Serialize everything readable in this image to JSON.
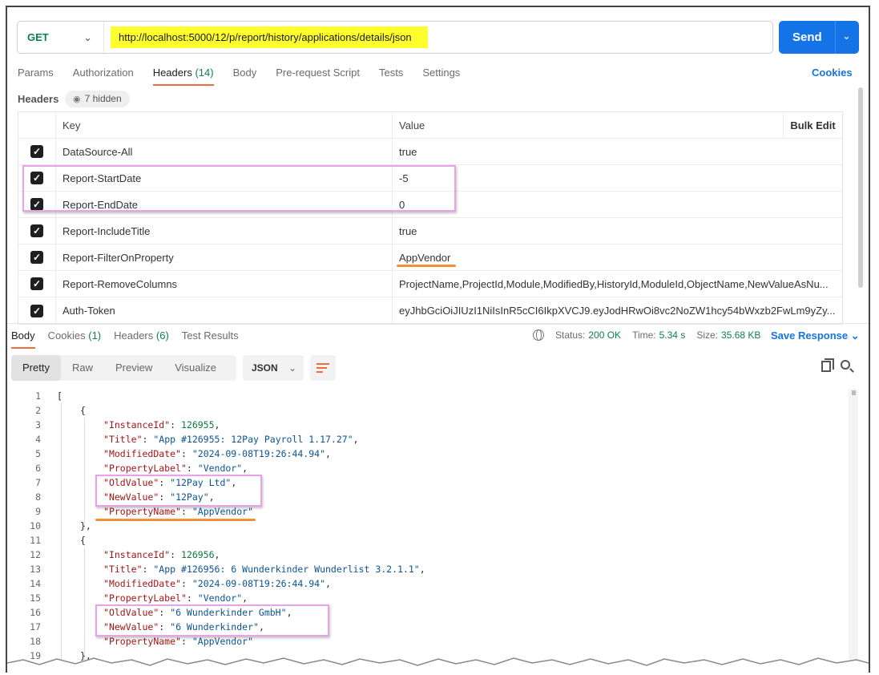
{
  "request": {
    "method": "GET",
    "url": "http://localhost:5000/12/p/report/history/applications/details/json",
    "send_label": "Send"
  },
  "req_tabs": [
    {
      "label": "Params",
      "count": ""
    },
    {
      "label": "Authorization",
      "count": ""
    },
    {
      "label": "Headers",
      "count": "(14)"
    },
    {
      "label": "Body",
      "count": ""
    },
    {
      "label": "Pre-request Script",
      "count": ""
    },
    {
      "label": "Tests",
      "count": ""
    },
    {
      "label": "Settings",
      "count": ""
    }
  ],
  "cookies_label": "Cookies",
  "headers_section": {
    "label": "Headers",
    "hidden_label": "7 hidden",
    "col_key": "Key",
    "col_value": "Value",
    "bulk_edit": "Bulk Edit",
    "rows": [
      {
        "key": "DataSource-All",
        "value": "true"
      },
      {
        "key": "Report-StartDate",
        "value": "-5"
      },
      {
        "key": "Report-EndDate",
        "value": "0"
      },
      {
        "key": "Report-IncludeTitle",
        "value": "true"
      },
      {
        "key": "Report-FilterOnProperty",
        "value": "AppVendor"
      },
      {
        "key": "Report-RemoveColumns",
        "value": "ProjectName,ProjectId,Module,ModifiedBy,HistoryId,ModuleId,ObjectName,NewValueAsNu..."
      },
      {
        "key": "Auth-Token",
        "value": "eyJhbGciOiJIUzI1NiIsInR5cCI6IkpXVCJ9.eyJodHRwOi8vc2NoZW1hcy54bWxzb2FwLm9yZy..."
      }
    ]
  },
  "resp_tabs": [
    {
      "label": "Body",
      "count": ""
    },
    {
      "label": "Cookies",
      "count": "(1)"
    },
    {
      "label": "Headers",
      "count": "(6)"
    },
    {
      "label": "Test Results",
      "count": ""
    }
  ],
  "status": {
    "status_label": "Status:",
    "status_value": "200 OK",
    "time_label": "Time:",
    "time_value": "5.34 s",
    "size_label": "Size:",
    "size_value": "35.68 KB"
  },
  "save_response": "Save Response",
  "view_modes": [
    "Pretty",
    "Raw",
    "Preview",
    "Visualize"
  ],
  "format": "JSON",
  "code_lines": [
    {
      "n": "1",
      "indent": 0,
      "text": "["
    },
    {
      "n": "2",
      "indent": 1,
      "text": "{"
    },
    {
      "n": "3",
      "indent": 2,
      "key": "InstanceId",
      "num": "126955",
      "tail": ","
    },
    {
      "n": "4",
      "indent": 2,
      "key": "Title",
      "str": "App #126955: 12Pay Payroll 1.17.27",
      "tail": ","
    },
    {
      "n": "5",
      "indent": 2,
      "key": "ModifiedDate",
      "str": "2024-09-08T19:26:44.94",
      "tail": ","
    },
    {
      "n": "6",
      "indent": 2,
      "key": "PropertyLabel",
      "str": "Vendor",
      "tail": ","
    },
    {
      "n": "7",
      "indent": 2,
      "key": "OldValue",
      "str": "12Pay Ltd",
      "tail": ","
    },
    {
      "n": "8",
      "indent": 2,
      "key": "NewValue",
      "str": "12Pay",
      "tail": ","
    },
    {
      "n": "9",
      "indent": 2,
      "key": "PropertyName",
      "str": "AppVendor",
      "tail": ""
    },
    {
      "n": "10",
      "indent": 1,
      "text": "},"
    },
    {
      "n": "11",
      "indent": 1,
      "text": "{"
    },
    {
      "n": "12",
      "indent": 2,
      "key": "InstanceId",
      "num": "126956",
      "tail": ","
    },
    {
      "n": "13",
      "indent": 2,
      "key": "Title",
      "str": "App #126956: 6 Wunderkinder Wunderlist 3.2.1.1",
      "tail": ","
    },
    {
      "n": "14",
      "indent": 2,
      "key": "ModifiedDate",
      "str": "2024-09-08T19:26:44.94",
      "tail": ","
    },
    {
      "n": "15",
      "indent": 2,
      "key": "PropertyLabel",
      "str": "Vendor",
      "tail": ","
    },
    {
      "n": "16",
      "indent": 2,
      "key": "OldValue",
      "str": "6 Wunderkinder GmbH",
      "tail": ","
    },
    {
      "n": "17",
      "indent": 2,
      "key": "NewValue",
      "str": "6 Wunderkinder",
      "tail": ","
    },
    {
      "n": "18",
      "indent": 2,
      "key": "PropertyName",
      "str": "AppVendor",
      "tail": ""
    },
    {
      "n": "19",
      "indent": 1,
      "text": "},"
    }
  ]
}
